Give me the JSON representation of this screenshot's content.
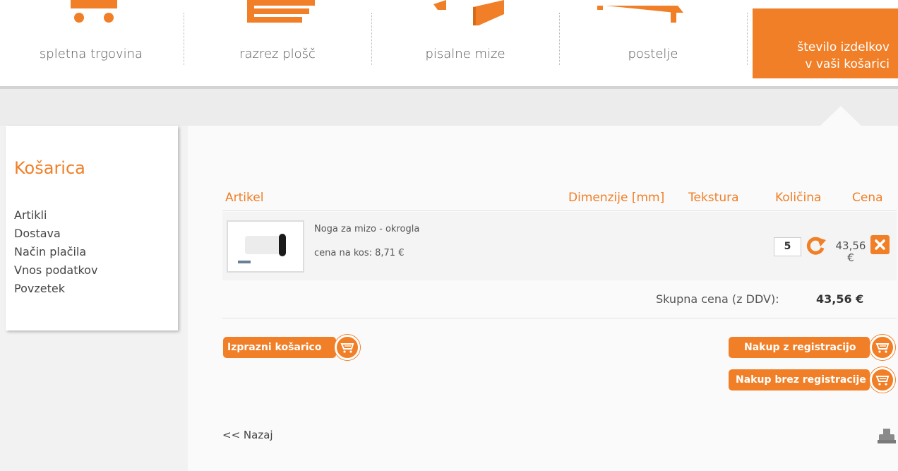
{
  "nav": {
    "items": [
      {
        "label": "spletna trgovina",
        "icon": "cart-icon"
      },
      {
        "label": "razrez plošč",
        "icon": "panels-icon"
      },
      {
        "label": "pisalne mize",
        "icon": "desk-icon"
      },
      {
        "label": "postelje",
        "icon": "bed-icon"
      }
    ],
    "cart_line1": "število izdelkov",
    "cart_line2": "v vaši košarici"
  },
  "sidebar": {
    "title": "Košarica",
    "items": [
      "Artikli",
      "Dostava",
      "Način plačila",
      "Vnos podatkov",
      "Povzetek"
    ]
  },
  "table": {
    "headers": {
      "article": "Artikel",
      "dimensions": "Dimenzije [mm]",
      "texture": "Tekstura",
      "quantity": "Količina",
      "price": "Cena"
    },
    "rows": [
      {
        "name": "Noga za mizo - okrogla",
        "unit_price": "cena na kos: 8,71 €",
        "quantity": "5",
        "price_value": "43,56",
        "price_currency": "€"
      }
    ]
  },
  "total": {
    "label": "Skupna cena (z DDV):",
    "value": "43,56 €"
  },
  "buttons": {
    "empty_cart": "Izprazni košarico",
    "buy_registered": "Nakup z registracijo",
    "buy_guest": "Nakup brez registracije"
  },
  "back_link": "<< Nazaj",
  "colors": {
    "accent": "#f07f27",
    "text": "#444444",
    "background": "#f2f2f2"
  }
}
